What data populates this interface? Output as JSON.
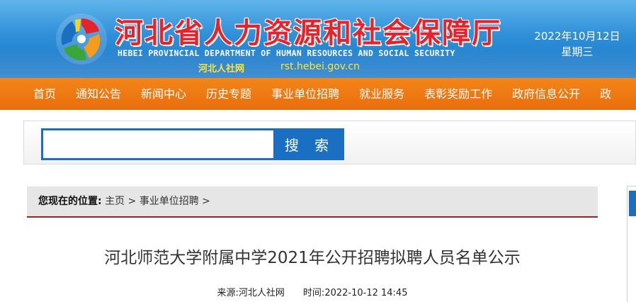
{
  "header": {
    "title": "河北省人力资源和社会保障厅",
    "subtitle": "HEBEI PROVINCIAL DEPARTMENT OF HUMAN RESOURCES AND SOCIAL SECURITY",
    "site_name": "河北人社网",
    "site_url": "rst.hebei.gov.cn",
    "date": "2022年10月12日",
    "weekday": "星期三",
    "logo_icon": "pinwheel-logo-icon",
    "colors": {
      "title": "#e8222a",
      "banner": "#2f8fd8",
      "site_info": "#ffe43a"
    }
  },
  "nav": {
    "items": [
      "首页",
      "通知公告",
      "新闻中心",
      "历史专题",
      "事业单位招聘",
      "就业服务",
      "表彰奖励工作",
      "政府信息公开",
      "政"
    ],
    "color": "#ea6d0d"
  },
  "search": {
    "value": "",
    "placeholder": "",
    "button_label": "搜 索",
    "color": "#1b6fc3"
  },
  "breadcrumb": {
    "label": "您现在的位置:",
    "items": [
      "主页",
      "事业单位招聘"
    ],
    "separator": ">",
    "accent": "#b01c1c"
  },
  "article": {
    "title": "河北师范大学附属中学2021年公开招聘拟聘人员名单公示",
    "source_label": "来源:",
    "source": "河北人社网",
    "time_label": "时间:",
    "time": "2022-10-12 14:45"
  }
}
